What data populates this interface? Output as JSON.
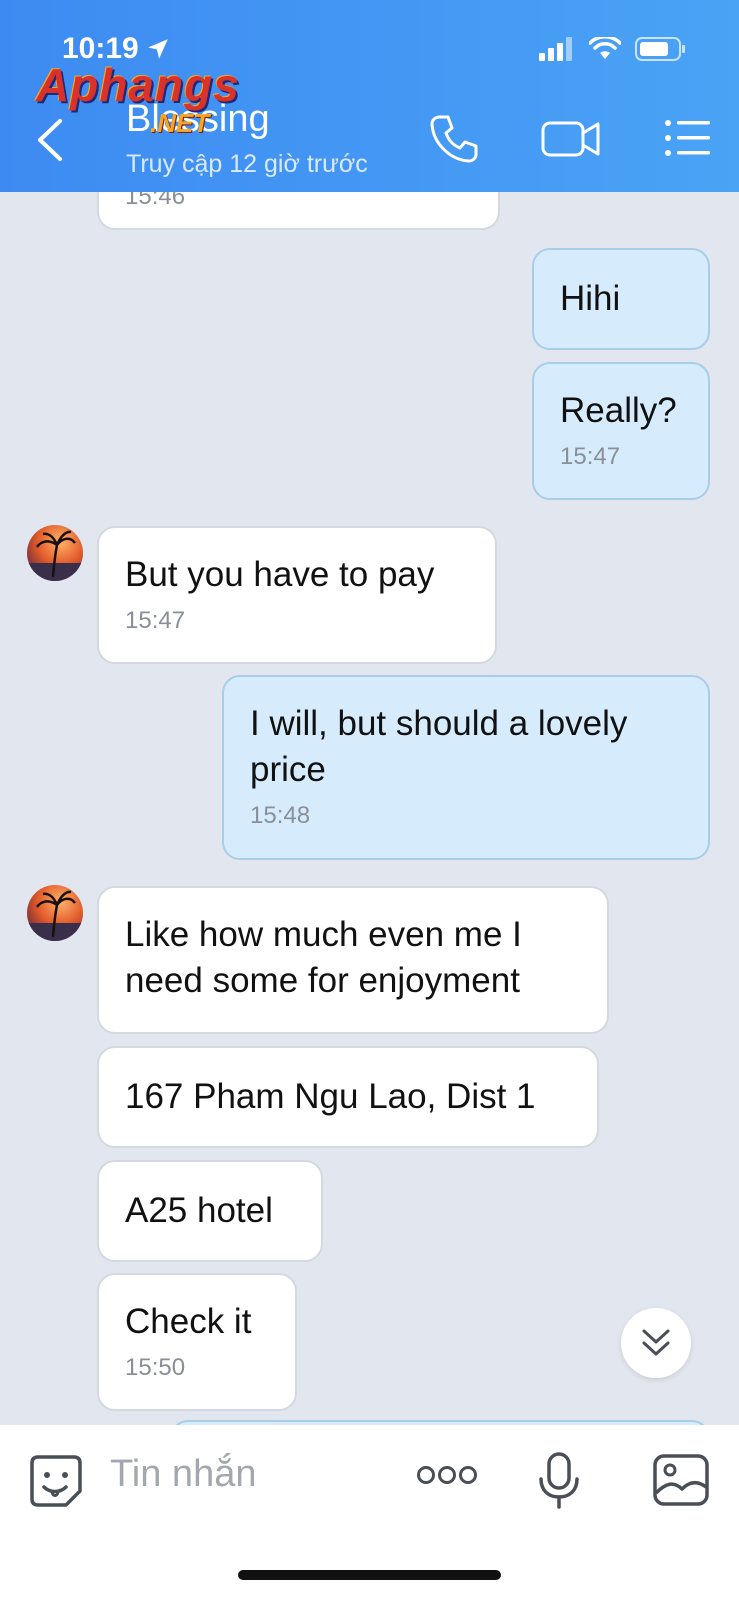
{
  "status_bar": {
    "time": "10:19"
  },
  "header": {
    "contact_name": "Blessing",
    "last_seen": "Truy cập 12 giờ trước",
    "watermark": "Aphangs",
    "watermark_suffix": ".NET"
  },
  "messages": [
    {
      "side": "in",
      "text": "",
      "time": "15:46"
    },
    {
      "side": "out",
      "text": "Hihi",
      "time": ""
    },
    {
      "side": "out",
      "text": "Really?",
      "time": "15:47"
    },
    {
      "side": "in",
      "text": "But you have to pay",
      "time": "15:47"
    },
    {
      "side": "out",
      "text": "I will, but should a lovely price",
      "time": "15:48"
    },
    {
      "side": "in",
      "text": "Like how much even me I need some for enjoyment",
      "time": ""
    },
    {
      "side": "in",
      "text": "167 Pham Ngu Lao, Dist 1",
      "time": ""
    },
    {
      "side": "in",
      "text": "A25 hotel",
      "time": ""
    },
    {
      "side": "in",
      "text": "Check it",
      "time": "15:50"
    }
  ],
  "composer": {
    "placeholder": "Tin nhắn"
  },
  "colors": {
    "header_start": "#3d8bf2",
    "header_end": "#4aa3f5",
    "outgoing_bubble": "#d6ecfd",
    "incoming_bubble": "#ffffff",
    "chat_bg": "#e2e6ee"
  }
}
